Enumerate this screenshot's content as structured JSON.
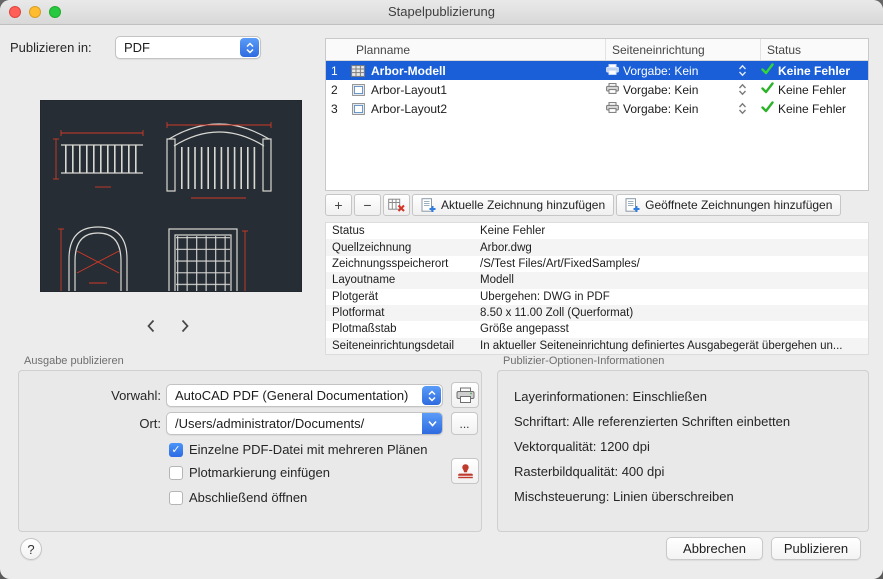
{
  "window": {
    "title": "Stapelpublizierung"
  },
  "colors": {
    "accent_blue": "#2e6be0",
    "selection_blue": "#1a5fd7",
    "success_green": "#2db22a",
    "preview_background": "#272d35",
    "cad_red": "#cf3a25"
  },
  "publish_in": {
    "label": "Publizieren in:",
    "value": "PDF"
  },
  "sheet_table": {
    "columns": [
      "Planname",
      "Seiteneinrichtung",
      "Status"
    ],
    "rows": [
      {
        "num": "1",
        "name": "Arbor-Modell",
        "setup": "Vorgabe: Kein",
        "status": "Keine Fehler",
        "selected": true
      },
      {
        "num": "2",
        "name": "Arbor-Layout1",
        "setup": "Vorgabe: Kein",
        "status": "Keine Fehler",
        "selected": false
      },
      {
        "num": "3",
        "name": "Arbor-Layout2",
        "setup": "Vorgabe: Kein",
        "status": "Keine Fehler",
        "selected": false
      }
    ],
    "toolbar": {
      "add_label": "+",
      "remove_label": "−",
      "add_current": "Aktuelle Zeichnung hinzufügen",
      "add_open": "Geöffnete Zeichnungen hinzufügen"
    }
  },
  "details": {
    "rows": [
      {
        "label": "Status",
        "value": "Keine Fehler"
      },
      {
        "label": "Quellzeichnung",
        "value": "Arbor.dwg"
      },
      {
        "label": "Zeichnungsspeicherort",
        "value": "/S/Test Files/Art/FixedSamples/"
      },
      {
        "label": "Layoutname",
        "value": "Modell"
      },
      {
        "label": "Plotgerät",
        "value": "Übergehen: DWG in PDF"
      },
      {
        "label": "Plotformat",
        "value": "8.50 x 11.00 Zoll (Querformat)"
      },
      {
        "label": "Plotmaßstab",
        "value": "Größe angepasst"
      },
      {
        "label": "Seiteneinrichtungsdetail",
        "value": "In aktueller Seiteneinrichtung definiertes Ausgabegerät übergehen un..."
      }
    ]
  },
  "output_group": {
    "title": "Ausgabe publizieren",
    "preset_label": "Vorwahl:",
    "preset_value": "AutoCAD PDF (General Documentation)",
    "location_label": "Ort:",
    "location_value": "/Users/administrator/Documents/",
    "browse_label": "...",
    "checkboxes": [
      {
        "label": "Einzelne PDF-Datei mit mehreren Plänen",
        "checked": true
      },
      {
        "label": "Plotmarkierung einfügen",
        "checked": false
      },
      {
        "label": "Abschließend öffnen",
        "checked": false
      }
    ]
  },
  "options_info": {
    "title": "Publizier-Optionen-Informationen",
    "items": [
      {
        "label": "Layerinformationen:",
        "value": "Einschließen"
      },
      {
        "label": "Schriftart:",
        "value": "Alle referenzierten Schriften einbetten"
      },
      {
        "label": "Vektorqualität:",
        "value": "1200 dpi"
      },
      {
        "label": "Rasterbildqualität:",
        "value": "400 dpi"
      },
      {
        "label": "Mischsteuerung:",
        "value": "Linien überschreiben"
      }
    ]
  },
  "footer": {
    "help": "?",
    "cancel": "Abbrechen",
    "publish": "Publizieren"
  }
}
